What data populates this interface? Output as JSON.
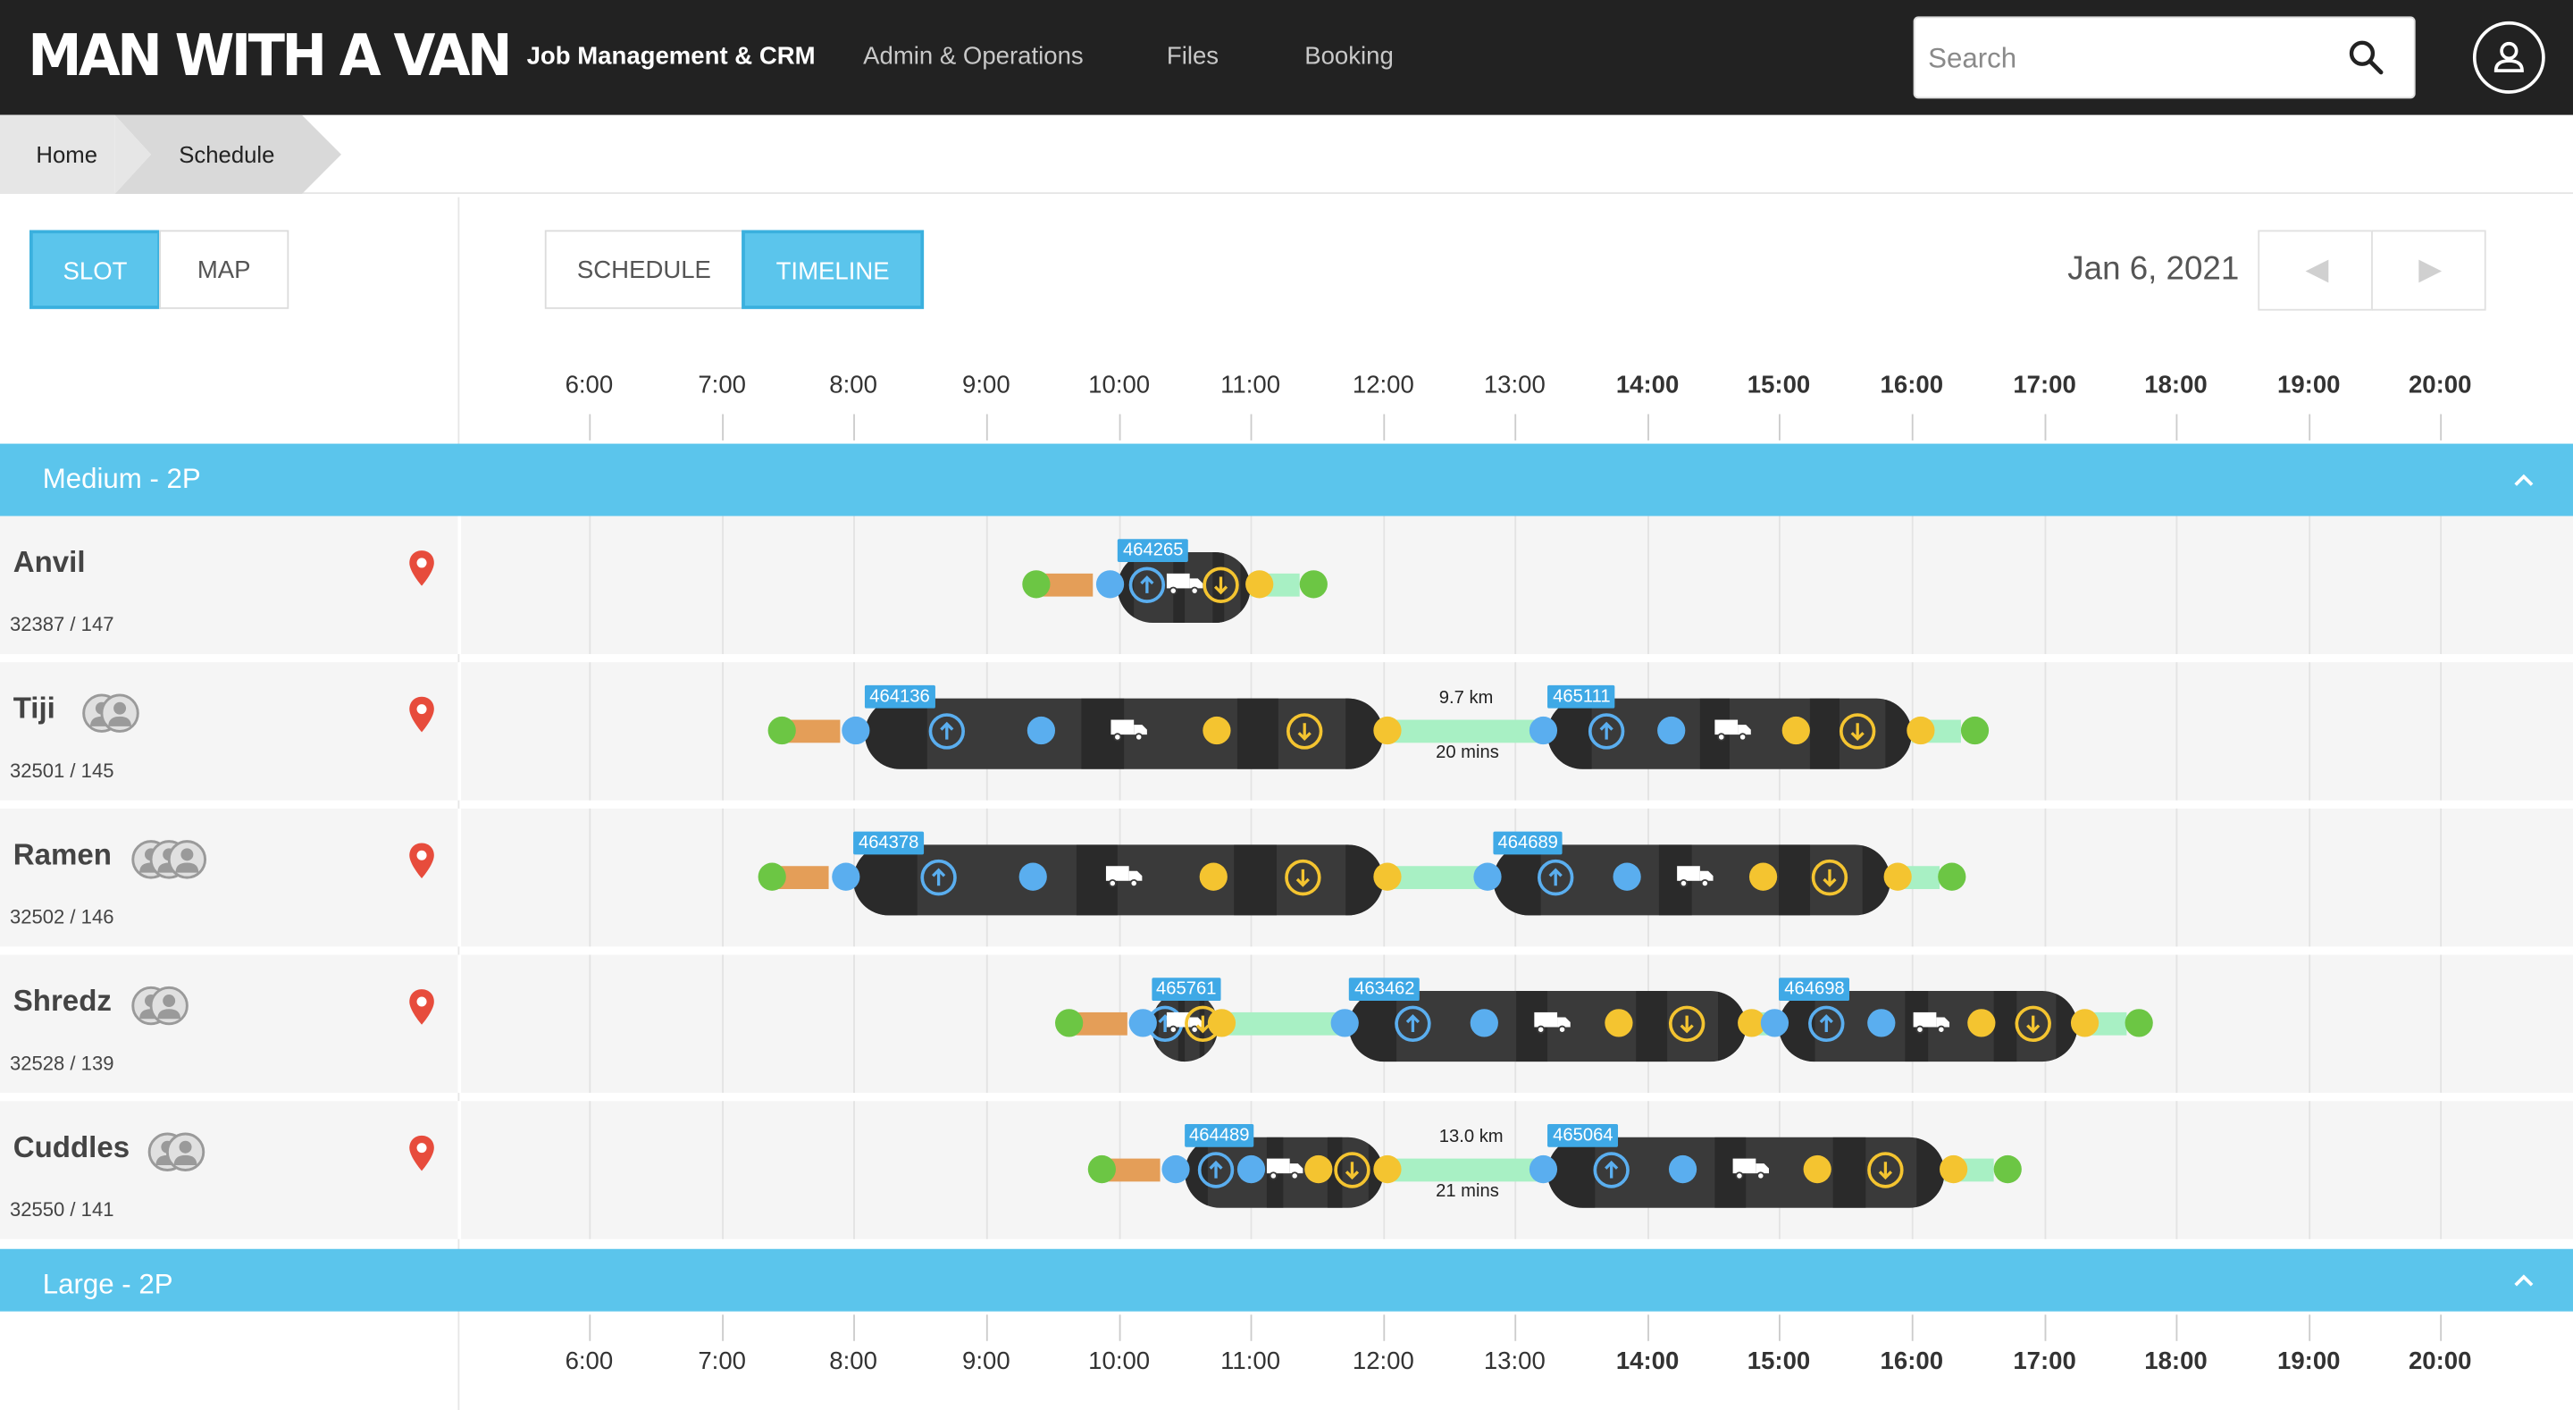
{
  "app": {
    "logo_text": "MAN WITH A VAN",
    "nav": [
      "Job Management & CRM",
      "Admin & Operations",
      "Files",
      "Booking"
    ],
    "search_placeholder": "Search"
  },
  "breadcrumb": [
    "Home",
    "Schedule"
  ],
  "controls": {
    "view_modes": [
      "SLOT",
      "MAP"
    ],
    "active_view_mode": "SLOT",
    "display_modes": [
      "SCHEDULE",
      "TIMELINE"
    ],
    "active_display_mode": "TIMELINE",
    "date": "Jan 6, 2021"
  },
  "time_axis": [
    "6:00",
    "7:00",
    "8:00",
    "9:00",
    "10:00",
    "11:00",
    "12:00",
    "13:00",
    "14:00",
    "15:00",
    "16:00",
    "17:00",
    "18:00",
    "19:00",
    "20:00"
  ],
  "groups": [
    {
      "label": "Medium - 2P",
      "rows": [
        {
          "name": "Anvil",
          "sub": "32387 / 147",
          "crew": 0,
          "jobs": [
            {
              "id": "464265",
              "start": "10:00",
              "end": "11:00"
            }
          ],
          "travel": []
        },
        {
          "name": "Tiji",
          "sub": "32501 / 145",
          "crew": 2,
          "jobs": [
            {
              "id": "464136",
              "start": "8:05",
              "end": "12:00"
            },
            {
              "id": "465111",
              "start": "13:15",
              "end": "16:00"
            }
          ],
          "travel": [
            {
              "distance": "9.7 km",
              "duration": "20 mins"
            }
          ]
        },
        {
          "name": "Ramen",
          "sub": "32502 / 146",
          "crew": 3,
          "jobs": [
            {
              "id": "464378",
              "start": "8:00",
              "end": "12:00"
            },
            {
              "id": "464689",
              "start": "12:50",
              "end": "15:50"
            }
          ],
          "travel": []
        },
        {
          "name": "Shredz",
          "sub": "32528 / 139",
          "crew": 2,
          "jobs": [
            {
              "id": "465761",
              "start": "10:15",
              "end": "10:45"
            },
            {
              "id": "463462",
              "start": "11:45",
              "end": "14:45"
            },
            {
              "id": "464698",
              "start": "15:00",
              "end": "17:15"
            }
          ],
          "travel": []
        },
        {
          "name": "Cuddles",
          "sub": "32550 / 141",
          "crew": 2,
          "jobs": [
            {
              "id": "464489",
              "start": "10:30",
              "end": "12:00"
            },
            {
              "id": "465064",
              "start": "13:15",
              "end": "16:15"
            }
          ],
          "travel": [
            {
              "distance": "13.0 km",
              "duration": "21 mins"
            }
          ]
        }
      ]
    },
    {
      "label": "Large - 2P",
      "rows": []
    }
  ],
  "colors": {
    "topbar": "#222222",
    "accent": "#5bc5ec",
    "job": "#3a3a3a",
    "pickup": "#5aaeef",
    "dropoff": "#f4c430",
    "start_end": "#6cc644",
    "travel": "#a8f0c4",
    "prep": "#e49e58",
    "pin": "#e74c3c"
  }
}
